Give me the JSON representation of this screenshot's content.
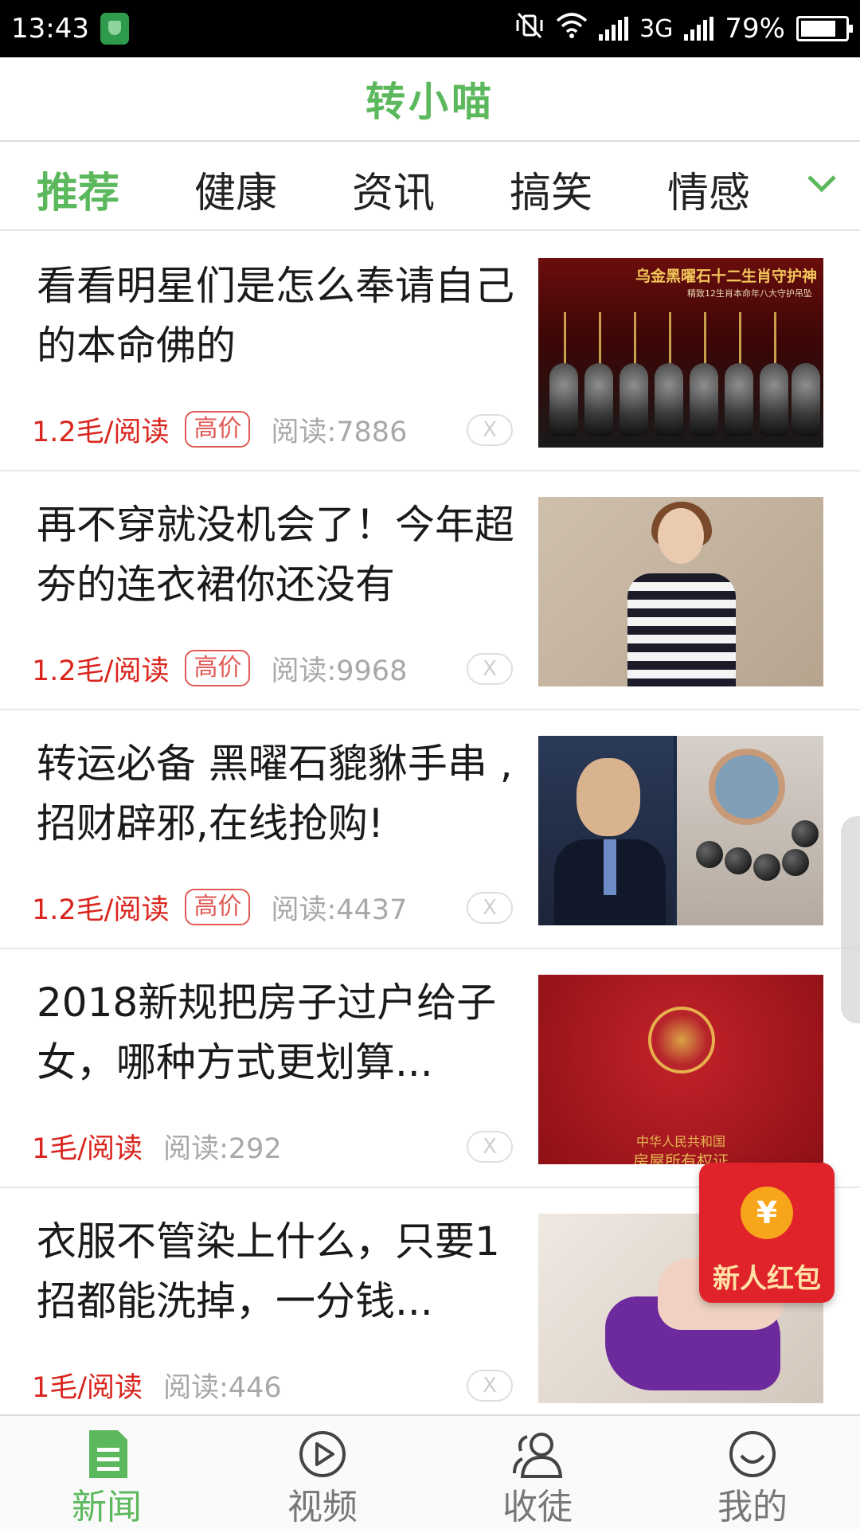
{
  "status_bar": {
    "time": "13:43",
    "network": "3G",
    "battery": "79%",
    "battery_level": 0.79
  },
  "header": {
    "title": "转小喵"
  },
  "tabs": [
    {
      "label": "推荐",
      "active": true
    },
    {
      "label": "健康",
      "active": false
    },
    {
      "label": "资讯",
      "active": false
    },
    {
      "label": "搞笑",
      "active": false
    },
    {
      "label": "情感",
      "active": false
    }
  ],
  "feed": [
    {
      "title": "看看明星们是怎么奉请自己的本命佛的",
      "price": "1.2毛/阅读",
      "badge": "高价",
      "reads": "阅读:7886",
      "dismiss": "X",
      "thumb_text": [
        "乌金黑曜石十二生肖守护神",
        "精致12生肖本命年八大守护吊坠"
      ]
    },
    {
      "title": "再不穿就没机会了！今年超夯的连衣裙你还没有",
      "price": "1.2毛/阅读",
      "badge": "高价",
      "reads": "阅读:9968",
      "dismiss": "X"
    },
    {
      "title": "转运必备 黑曜石貔貅手串 ,招财辟邪,在线抢购!",
      "price": "1.2毛/阅读",
      "badge": "高价",
      "reads": "阅读:4437",
      "dismiss": "X"
    },
    {
      "title": "2018新规把房子过户给子女，哪种方式更划算...",
      "price": "1毛/阅读",
      "badge": "",
      "reads": "阅读:292",
      "dismiss": "X",
      "thumb_text": [
        "中华人民共和国",
        "房屋所有权证"
      ]
    },
    {
      "title": "衣服不管染上什么，只要1招都能洗掉，一分钱...",
      "price": "1毛/阅读",
      "badge": "",
      "reads": "阅读:446",
      "dismiss": "X"
    }
  ],
  "red_envelope": {
    "coin": "¥",
    "label": "新人红包"
  },
  "bottom_nav": [
    {
      "label": "新闻",
      "icon": "news-icon",
      "active": true
    },
    {
      "label": "视频",
      "icon": "play-icon",
      "active": false
    },
    {
      "label": "收徒",
      "icon": "people-icon",
      "active": false
    },
    {
      "label": "我的",
      "icon": "smile-icon",
      "active": false
    }
  ],
  "colors": {
    "brand_green": "#5cb85c",
    "price_red": "#d9251d",
    "status_bar": "#000000",
    "envelope_red": "#e0232b"
  }
}
